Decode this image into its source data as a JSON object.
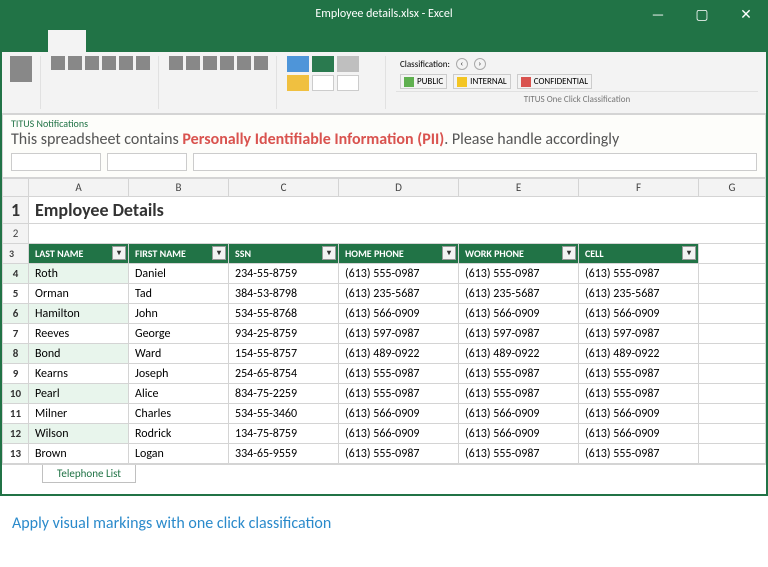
{
  "window": {
    "title": "Employee details.xlsx - Excel"
  },
  "titlebar_buttons": {
    "min": "—",
    "max": "▢",
    "close": "✕"
  },
  "ribbon_tabs": [
    " ",
    " ",
    " ",
    " ",
    " ",
    " "
  ],
  "classification": {
    "label": "Classification:",
    "options": [
      {
        "name": "PUBLIC",
        "color": "#5fb04f"
      },
      {
        "name": "INTERNAL",
        "color": "#f3c523"
      },
      {
        "name": "CONFIDENTIAL",
        "color": "#d9534f"
      }
    ],
    "group_caption": "TITUS One Click Classification"
  },
  "notification": {
    "heading": "TITUS Notifications",
    "pre": "This spreadsheet contains ",
    "highlight": "Personally Identifiable Information (PII)",
    "post": ". Please handle accordingly"
  },
  "columns": [
    "A",
    "B",
    "C",
    "D",
    "E",
    "F",
    "G"
  ],
  "sheet_title": "Employee Details",
  "headers": [
    "LAST NAME",
    "FIRST NAME",
    "SSN",
    "HOME PHONE",
    "WORK PHONE",
    "CELL"
  ],
  "rows": [
    {
      "last": "Roth",
      "first": "Daniel",
      "ssn": "234-55-8759",
      "home": "(613) 555-0987",
      "work": "(613) 555-0987",
      "cell": "(613) 555-0987"
    },
    {
      "last": "Orman",
      "first": "Tad",
      "ssn": "384-53-8798",
      "home": "(613) 235-5687",
      "work": "(613) 235-5687",
      "cell": "(613) 235-5687"
    },
    {
      "last": "Hamilton",
      "first": "John",
      "ssn": "534-55-8768",
      "home": "(613) 566-0909",
      "work": "(613) 566-0909",
      "cell": "(613) 566-0909"
    },
    {
      "last": "Reeves",
      "first": "George",
      "ssn": "934-25-8759",
      "home": "(613) 597-0987",
      "work": "(613) 597-0987",
      "cell": "(613) 597-0987"
    },
    {
      "last": "Bond",
      "first": "Ward",
      "ssn": "154-55-8757",
      "home": "(613) 489-0922",
      "work": "(613) 489-0922",
      "cell": "(613) 489-0922"
    },
    {
      "last": "Kearns",
      "first": "Joseph",
      "ssn": "254-65-8754",
      "home": "(613) 555-0987",
      "work": "(613) 555-0987",
      "cell": "(613) 555-0987"
    },
    {
      "last": "Pearl",
      "first": "Alice",
      "ssn": "834-75-2259",
      "home": "(613) 555-0987",
      "work": "(613) 555-0987",
      "cell": "(613) 555-0987"
    },
    {
      "last": "Milner",
      "first": "Charles",
      "ssn": "534-55-3460",
      "home": "(613) 566-0909",
      "work": "(613) 566-0909",
      "cell": "(613) 566-0909"
    },
    {
      "last": "Wilson",
      "first": "Rodrick",
      "ssn": "134-75-8759",
      "home": "(613) 566-0909",
      "work": "(613) 566-0909",
      "cell": "(613) 566-0909"
    },
    {
      "last": "Brown",
      "first": "Logan",
      "ssn": "334-65-9559",
      "home": "(613) 555-0987",
      "work": "(613) 555-0987",
      "cell": "(613) 555-0987"
    }
  ],
  "sheet_tab": "Telephone List",
  "caption": "Apply visual markings with one click classification"
}
